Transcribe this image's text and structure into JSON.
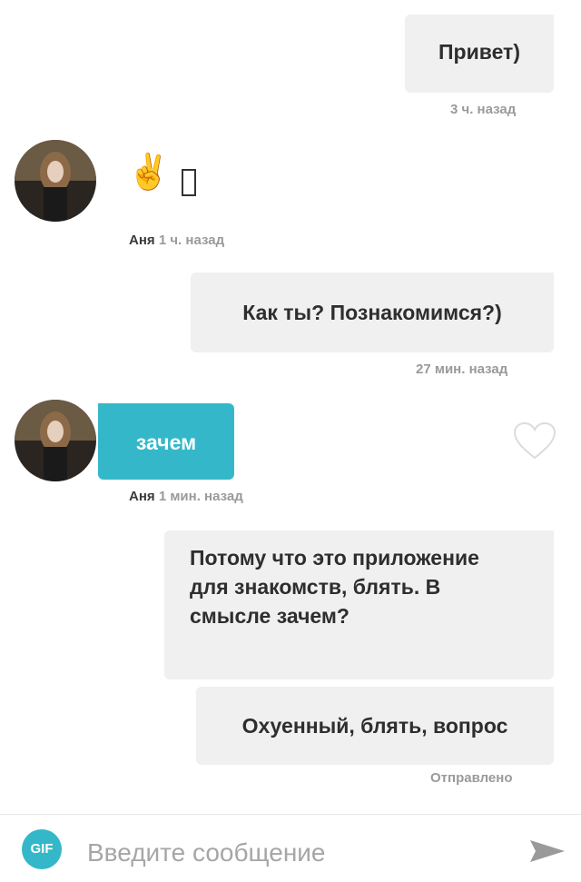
{
  "messages": [
    {
      "text": "Привет)",
      "time": "3 ч. назад"
    },
    {
      "sender": "Аня",
      "time": "1 ч. назад",
      "emoji": "✌️"
    },
    {
      "text": "Как ты? Познакомимся?)",
      "time": "27 мин. назад"
    },
    {
      "sender": "Аня",
      "text": "зачем",
      "time": "1 мин. назад"
    },
    {
      "text": "Потому что это приложение для знакомств, блять. В смысле зачем?"
    },
    {
      "text": "Охуенный, блять, вопрос",
      "status": "Отправлено"
    }
  ],
  "composer": {
    "gif_label": "GIF",
    "placeholder": "Введите сообщение"
  },
  "colors": {
    "accent": "#34b8c9",
    "bubble_out": "#f0f0f0",
    "meta_text": "#9a9a9a"
  },
  "icons": [
    "gif-icon",
    "heart-icon",
    "send-icon",
    "avatar-photo"
  ]
}
